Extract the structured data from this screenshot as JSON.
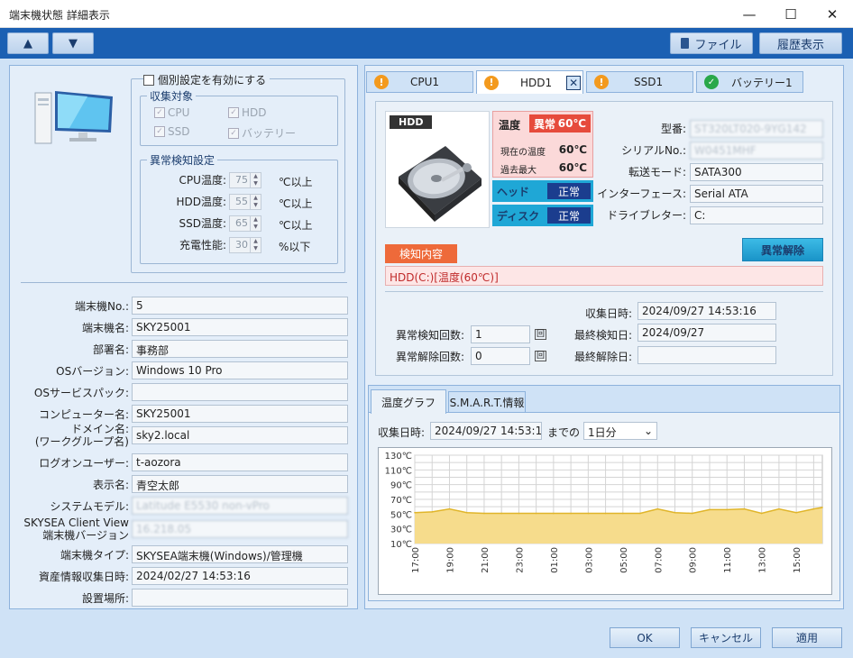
{
  "window": {
    "title": "端末機状態 詳細表示",
    "minimize": "—",
    "maximize": "☐",
    "close": "✕"
  },
  "toolbar": {
    "up": "▲",
    "down": "▼",
    "file": "ファイル",
    "history": "履歴表示"
  },
  "settings": {
    "enable_label": "個別設定を有効にする",
    "collect_title": "収集対象",
    "collect_items": [
      {
        "label": "CPU",
        "checked": true
      },
      {
        "label": "HDD",
        "checked": true
      },
      {
        "label": "SSD",
        "checked": true
      },
      {
        "label": "バッテリー",
        "checked": true
      }
    ],
    "detect_title": "異常検知設定",
    "detect_rows": [
      {
        "label": "CPU温度:",
        "value": "75",
        "unit": "℃以上"
      },
      {
        "label": "HDD温度:",
        "value": "55",
        "unit": "℃以上"
      },
      {
        "label": "SSD温度:",
        "value": "65",
        "unit": "℃以上"
      },
      {
        "label": "充電性能:",
        "value": "30",
        "unit": "%以下"
      }
    ]
  },
  "info": [
    {
      "label": "端末機No.:",
      "value": "5",
      "blur": false
    },
    {
      "label": "端末機名:",
      "value": "SKY25001",
      "blur": false
    },
    {
      "label": "部署名:",
      "value": "事務部",
      "blur": false
    },
    {
      "label": "OSバージョン:",
      "value": "Windows 10 Pro",
      "blur": false
    },
    {
      "label": "OSサービスパック:",
      "value": "",
      "blur": false
    },
    {
      "label": "コンピューター名:",
      "value": "SKY25001",
      "blur": false
    },
    {
      "label": "ドメイン名:",
      "label2": "(ワークグループ名)",
      "value": "sky2.local",
      "blur": false
    },
    {
      "label": "ログオンユーザー:",
      "value": "t-aozora",
      "blur": false
    },
    {
      "label": "表示名:",
      "value": "青空太郎",
      "blur": false
    },
    {
      "label": "システムモデル:",
      "value": "Latitude E5530 non-vPro",
      "blur": true
    },
    {
      "label": "SKYSEA Client View",
      "label2": "端末機バージョン",
      "value": "16.218.05",
      "blur": true
    },
    {
      "label": "端末機タイプ:",
      "value": "SKYSEA端末機(Windows)/管理機",
      "blur": false
    },
    {
      "label": "資産情報収集日時:",
      "value": "2024/02/27 14:53:16",
      "blur": false
    },
    {
      "label": "設置場所:",
      "value": "",
      "blur": false
    }
  ],
  "tabs": [
    {
      "label": "CPU1",
      "status": "warn",
      "active": false
    },
    {
      "label": "HDD1",
      "status": "warn",
      "active": true
    },
    {
      "label": "SSD1",
      "status": "warn",
      "active": false
    },
    {
      "label": "バッテリー1",
      "status": "ok",
      "active": false
    }
  ],
  "hdd": {
    "badge": "HDD",
    "temp_label": "温度",
    "temp_status": "異常",
    "temp_value": "60℃",
    "cur_label": "現在の温度",
    "cur_value": "60℃",
    "max_label": "過去最大",
    "max_value": "60℃",
    "head_label": "ヘッド",
    "head_status": "正常",
    "disk_label": "ディスク",
    "disk_status": "正常",
    "props": [
      {
        "label": "型番:",
        "value": "ST320LT020-9YG142",
        "blur": true
      },
      {
        "label": "シリアルNo.:",
        "value": "W0451MHF",
        "blur": true
      },
      {
        "label": "転送モード:",
        "value": "SATA300",
        "blur": false
      },
      {
        "label": "インターフェース:",
        "value": "Serial ATA",
        "blur": false
      },
      {
        "label": "ドライブレター:",
        "value": "C:",
        "blur": false
      }
    ],
    "detect_badge": "検知内容",
    "clear_button": "異常解除",
    "detect_text": "HDD(C:)[温度(60℃)]",
    "collected_label": "収集日時:",
    "collected_value": "2024/09/27 14:53:16",
    "detect_count_label": "異常検知回数:",
    "detect_count": "1",
    "count_unit": "回",
    "last_detect_label": "最終検知日:",
    "last_detect": "2024/09/27",
    "clear_count_label": "異常解除回数:",
    "clear_count": "0",
    "count_unit2": "回",
    "last_clear_label": "最終解除日:",
    "last_clear": ""
  },
  "graph": {
    "tab1": "温度グラフ",
    "tab2": "S.M.A.R.T.情報",
    "collected_label": "収集日時:",
    "collected_value": "2024/09/27 14:53:16",
    "until_label": "までの",
    "range_value": "1日分",
    "range_arrow": "⌄"
  },
  "chart_data": {
    "type": "area",
    "y_ticks": [
      "130℃",
      "110℃",
      "90℃",
      "70℃",
      "50℃",
      "30℃",
      "10℃"
    ],
    "ylim": [
      10,
      130
    ],
    "x_ticks": [
      "17:00",
      "19:00",
      "21:00",
      "23:00",
      "01:00",
      "03:00",
      "05:00",
      "07:00",
      "09:00",
      "11:00",
      "13:00",
      "15:00"
    ],
    "x_hours": [
      0,
      1,
      2,
      3,
      4,
      5,
      6,
      7,
      8,
      9,
      10,
      11,
      12,
      13,
      14,
      15,
      16,
      17,
      18,
      19,
      20,
      21,
      22,
      23,
      23.5
    ],
    "values": [
      52,
      53,
      57,
      52,
      51,
      51,
      51,
      51,
      51,
      51,
      51,
      51,
      51,
      51,
      57,
      52,
      51,
      56,
      56,
      57,
      51,
      57,
      52,
      57,
      59
    ],
    "colors": {
      "fill": "#f6dc8c",
      "line": "#e0b52a",
      "grid": "#d4d4d4"
    }
  },
  "footer": {
    "ok": "OK",
    "cancel": "キャンセル",
    "apply": "適用"
  }
}
